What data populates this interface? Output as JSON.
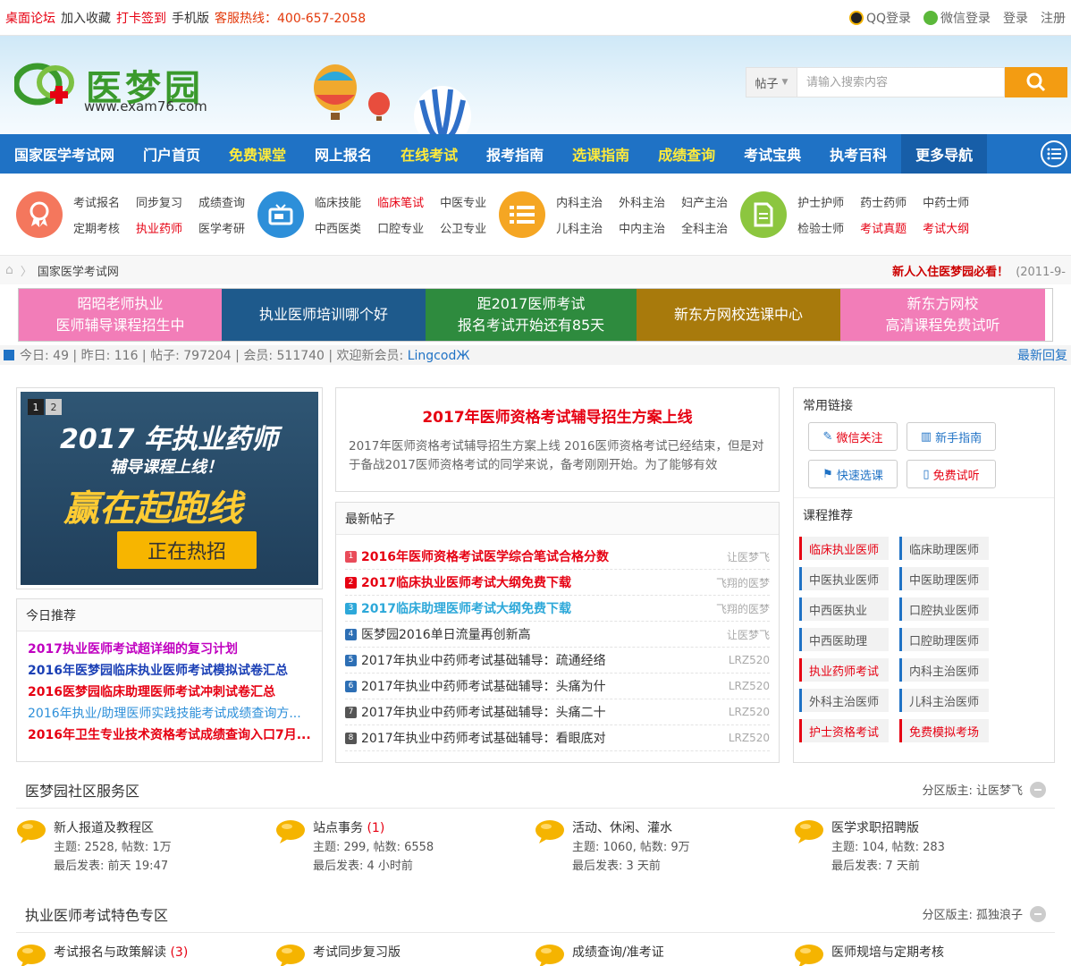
{
  "topbar": {
    "left": [
      {
        "text": "桌面论坛",
        "color": "red"
      },
      {
        "text": "加入收藏",
        "color": "normal"
      },
      {
        "text": "打卡签到",
        "color": "red"
      },
      {
        "text": "手机版",
        "color": "normal"
      },
      {
        "text": "客服热线：400-657-2058",
        "color": "orange"
      }
    ],
    "qq_login": "QQ登录",
    "wechat_login": "微信登录",
    "login": "登录",
    "register": "注册"
  },
  "header": {
    "logo_text": "医梦园",
    "logo_url": "www.exam76.com",
    "search_type": "帖子",
    "search_placeholder": "请输入搜索内容"
  },
  "nav": [
    {
      "label": "国家医学考试网",
      "hl": false
    },
    {
      "label": "门户首页",
      "hl": false
    },
    {
      "label": "免费课堂",
      "hl": true
    },
    {
      "label": "网上报名",
      "hl": false
    },
    {
      "label": "在线考试",
      "hl": true
    },
    {
      "label": "报考指南",
      "hl": false
    },
    {
      "label": "选课指南",
      "hl": true
    },
    {
      "label": "成绩查询",
      "hl": true
    },
    {
      "label": "考试宝典",
      "hl": false
    },
    {
      "label": "执考百科",
      "hl": false
    },
    {
      "label": "更多导航",
      "hl": false
    }
  ],
  "quick": [
    {
      "icon": "award-icon",
      "color": "#f4775d",
      "links": [
        {
          "t": "考试报名",
          "red": false
        },
        {
          "t": "同步复习",
          "red": false
        },
        {
          "t": "成绩查询",
          "red": false
        },
        {
          "t": "定期考核",
          "red": false
        },
        {
          "t": "执业药师",
          "red": true
        },
        {
          "t": "医学考研",
          "red": false
        }
      ]
    },
    {
      "icon": "tv-icon",
      "color": "#2d8fd9",
      "links": [
        {
          "t": "临床技能",
          "red": false
        },
        {
          "t": "临床笔试",
          "red": true
        },
        {
          "t": "中医专业",
          "red": false
        },
        {
          "t": "中西医类",
          "red": false
        },
        {
          "t": "口腔专业",
          "red": false
        },
        {
          "t": "公卫专业",
          "red": false
        }
      ]
    },
    {
      "icon": "list-icon",
      "color": "#f5a623",
      "links": [
        {
          "t": "内科主治",
          "red": false
        },
        {
          "t": "外科主治",
          "red": false
        },
        {
          "t": "妇产主治",
          "red": false
        },
        {
          "t": "儿科主治",
          "red": false
        },
        {
          "t": "中内主治",
          "red": false
        },
        {
          "t": "全科主治",
          "red": false
        }
      ]
    },
    {
      "icon": "document-icon",
      "color": "#8cc63f",
      "links": [
        {
          "t": "护士护师",
          "red": false
        },
        {
          "t": "药士药师",
          "red": false
        },
        {
          "t": "中药士师",
          "red": false
        },
        {
          "t": "检验士师",
          "red": false
        },
        {
          "t": "考试真题",
          "red": true
        },
        {
          "t": "考试大纲",
          "red": true
        }
      ]
    }
  ],
  "breadcrumb": {
    "current": "国家医学考试网",
    "notice": "新人入住医梦园必看！",
    "notice_date": "(2011-9-"
  },
  "banners": [
    {
      "text": "昭昭老师执业\n医师辅导课程招生中",
      "bg": "#f27db8",
      "w": 227
    },
    {
      "text": "执业医师培训哪个好",
      "bg": "#1e5a8c",
      "w": 228
    },
    {
      "text": "距2017医师考试\n报名考试开始还有85天",
      "bg": "#2e8b3e",
      "w": 236
    },
    {
      "text": "新东方网校选课中心",
      "bg": "#a87a0c",
      "w": 228
    },
    {
      "text": "新东方网校\n高清课程免费试听",
      "bg": "#f27db8",
      "w": 229
    }
  ],
  "stats": {
    "text": "今日: 49 | 昨日: 116 | 帖子: 797204 | 会员: 511740 | 欢迎新会员: ",
    "new_member": "LingcodЖ",
    "latest_reply": "最新回复"
  },
  "slider": {
    "dots": [
      "1",
      "2"
    ],
    "line1": "2017 年执业药师",
    "line2": "辅导课程上线！",
    "line3": "赢在起跑线",
    "cta": "正在热招"
  },
  "today": {
    "title": "今日推荐",
    "items": [
      {
        "t": "2017执业医师考试超详细的复习计划",
        "c": "#c000c0",
        "bold": true
      },
      {
        "t": "2016年医梦园临床执业医师考试模拟试卷汇总",
        "c": "#1a3fb5",
        "bold": true
      },
      {
        "t": "2016医梦园临床助理医师考试冲刺试卷汇总",
        "c": "#e60012",
        "bold": true
      },
      {
        "t": "2016年执业/助理医师实践技能考试成绩查询方...",
        "c": "#2d8fd9",
        "bold": false
      },
      {
        "t": "2016年卫生专业技术资格考试成绩查询入口7月...",
        "c": "#e60012",
        "bold": true
      }
    ]
  },
  "headline": {
    "title": "2017年医师资格考试辅导招生方案上线",
    "body": "2017年医师资格考试辅导招生方案上线 2016医师资格考试已经结束，但是对于备战2017医师资格考试的同学来说，备考刚刚开始。为了能够有效"
  },
  "posts": {
    "title": "最新帖子",
    "items": [
      {
        "n": "1",
        "t": "2016年医师资格考试医学综合笔试合格分数",
        "a": "让医梦飞",
        "c": "#e60012",
        "bold": true,
        "nc": "#e94c5a"
      },
      {
        "n": "2",
        "t": "2017临床执业医师考试大纲免费下载",
        "a": "飞翔的医梦",
        "c": "#e60012",
        "bold": true,
        "nc": "#e60012"
      },
      {
        "n": "3",
        "t": "2017临床助理医师考试大纲免费下载",
        "a": "飞翔的医梦",
        "c": "#2da8d9",
        "bold": true,
        "nc": "#2da8d9"
      },
      {
        "n": "4",
        "t": "医梦园2016单日流量再创新高",
        "a": "让医梦飞",
        "c": "#333",
        "bold": false,
        "nc": "#2d6fb5"
      },
      {
        "n": "5",
        "t": "2017年执业中药师考试基础辅导：疏通经络",
        "a": "LRZ520",
        "c": "#333",
        "bold": false,
        "nc": "#2d6fb5"
      },
      {
        "n": "6",
        "t": "2017年执业中药师考试基础辅导：头痛为什",
        "a": "LRZ520",
        "c": "#333",
        "bold": false,
        "nc": "#2d6fb5"
      },
      {
        "n": "7",
        "t": "2017年执业中药师考试基础辅导：头痛二十",
        "a": "LRZ520",
        "c": "#333",
        "bold": false,
        "nc": "#555"
      },
      {
        "n": "8",
        "t": "2017年执业中药师考试基础辅导：看眼底对",
        "a": "LRZ520",
        "c": "#333",
        "bold": false,
        "nc": "#555"
      }
    ]
  },
  "sidebar": {
    "links_title": "常用链接",
    "buttons": [
      {
        "t": "微信关注",
        "icon": "edit-icon",
        "c": "#e60012"
      },
      {
        "t": "新手指南",
        "icon": "chart-icon",
        "c": "#1f72c5"
      },
      {
        "t": "快速选课",
        "icon": "flag-icon",
        "c": "#1f72c5"
      },
      {
        "t": "免费试听",
        "icon": "book-icon",
        "c": "#e60012"
      }
    ],
    "courses_title": "课程推荐",
    "courses": [
      {
        "t": "临床执业医师",
        "red": true
      },
      {
        "t": "临床助理医师",
        "red": false
      },
      {
        "t": "中医执业医师",
        "red": false
      },
      {
        "t": "中医助理医师",
        "red": false
      },
      {
        "t": "中西医执业",
        "red": false
      },
      {
        "t": "口腔执业医师",
        "red": false
      },
      {
        "t": "中西医助理",
        "red": false
      },
      {
        "t": "口腔助理医师",
        "red": false
      },
      {
        "t": "执业药师考试",
        "red": true
      },
      {
        "t": "内科主治医师",
        "red": false
      },
      {
        "t": "外科主治医师",
        "red": false
      },
      {
        "t": "儿科主治医师",
        "red": false
      },
      {
        "t": "护士资格考试",
        "red": true
      },
      {
        "t": "免费模拟考场",
        "red": true
      }
    ]
  },
  "section1": {
    "title": "医梦园社区服务区",
    "moderator": "分区版主: 让医梦飞",
    "forums": [
      {
        "name": "新人报道及教程区",
        "count": "",
        "stat": "主题: 2528, 帖数: 1万",
        "last": "最后发表: 前天 19:47"
      },
      {
        "name": "站点事务",
        "count": "(1)",
        "stat": "主题: 299, 帖数: 6558",
        "last": "最后发表: 4 小时前"
      },
      {
        "name": "活动、休闲、灌水",
        "count": "",
        "stat": "主题: 1060, 帖数: 9万",
        "last": "最后发表: 3 天前"
      },
      {
        "name": "医学求职招聘版",
        "count": "",
        "stat": "主题: 104, 帖数: 283",
        "last": "最后发表: 7 天前"
      }
    ]
  },
  "section2": {
    "title": "执业医师考试特色专区",
    "moderator": "分区版主: 孤独浪子",
    "forums": [
      {
        "name": "考试报名与政策解读",
        "count": "(3)"
      },
      {
        "name": "考试同步复习版",
        "count": ""
      },
      {
        "name": "成绩查询/准考证",
        "count": ""
      },
      {
        "name": "医师规培与定期考核",
        "count": ""
      }
    ]
  },
  "colors": {
    "nav": "#1f72c5",
    "accent": "#e60012",
    "search": "#f39c12"
  }
}
